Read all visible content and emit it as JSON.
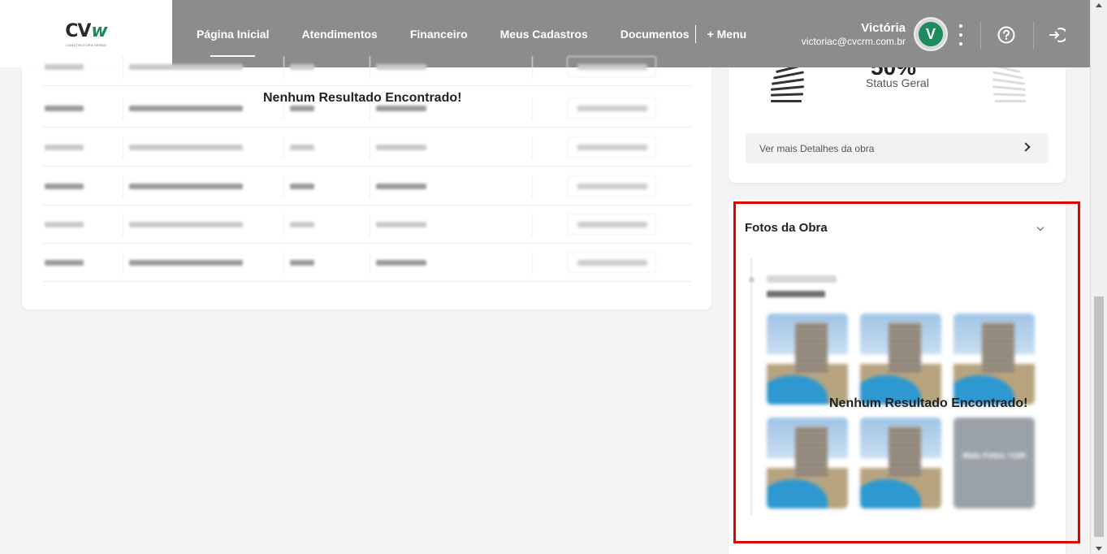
{
  "header": {
    "logo": {
      "text": "CV",
      "sub": "CONSTRUTORA VERDE"
    },
    "nav": [
      {
        "label": "Página Inicial",
        "active": true
      },
      {
        "label": "Atendimentos"
      },
      {
        "label": "Financeiro"
      },
      {
        "label": "Meus Cadastros"
      },
      {
        "label": "Documentos"
      }
    ],
    "menu_label": "+ Menu",
    "user": {
      "name": "Victória",
      "email": "victoriac@cvcrm.com.br",
      "initial": "V"
    },
    "icons": [
      "kebab-icon",
      "help-icon",
      "logout-icon"
    ]
  },
  "left_card": {
    "empty_message": "Nenhum Resultado Encontrado!",
    "row_count": 6
  },
  "status_card": {
    "percent": "50%",
    "status_label": "Status Geral",
    "details_button": "Ver mais Detalhes da obra"
  },
  "fotos_card": {
    "title": "Fotos da Obra",
    "empty_message": "Nenhum Resultado Encontrado!",
    "timeline_title": "Fotos da Obra",
    "timeline_date": "01/04/2020",
    "more_label": "Mais Fotos +100"
  },
  "colors": {
    "header_bg": "#8c8c8c",
    "brand_green": "#1f8a5e",
    "highlight": "#e00000"
  }
}
